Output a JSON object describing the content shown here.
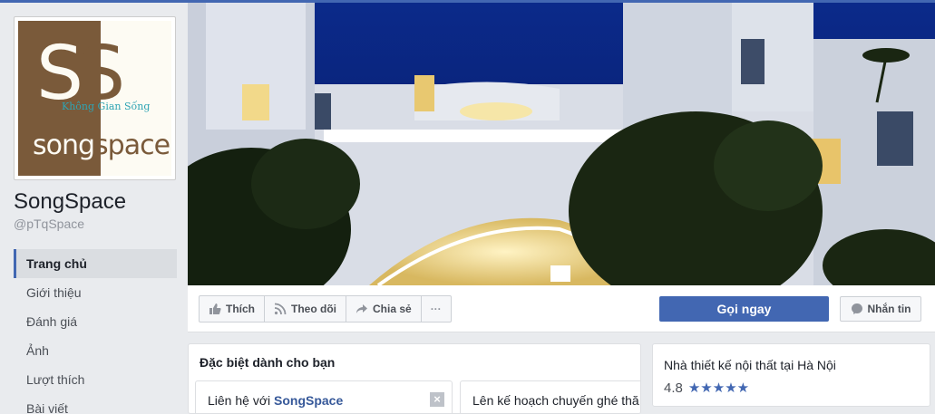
{
  "page": {
    "name": "SongSpace",
    "handle": "@pTqSpace"
  },
  "logo": {
    "letter1": "S",
    "letter2": "S",
    "tagline": "Không Gian Sống",
    "word_part1": "song",
    "word_part2": "space"
  },
  "nav": [
    {
      "label": "Trang chủ",
      "active": true
    },
    {
      "label": "Giới thiệu"
    },
    {
      "label": "Đánh giá"
    },
    {
      "label": "Ảnh"
    },
    {
      "label": "Lượt thích"
    },
    {
      "label": "Bài viết"
    }
  ],
  "actions": {
    "like": "Thích",
    "follow": "Theo dõi",
    "share": "Chia sẻ",
    "more": "···",
    "call": "Gọi ngay",
    "message": "Nhắn tin"
  },
  "special": {
    "title": "Đặc biệt dành cho bạn",
    "card1_prefix": "Liên hệ với",
    "card1_brand": "SongSpace",
    "card1_close": "×",
    "card2_text": "Lên kế hoạch chuyến ghé thă"
  },
  "info": {
    "description": "Nhà thiết kế nội thất tại Hà Nội",
    "rating_value": "4.8",
    "stars": "★★★★★"
  },
  "colors": {
    "brand_blue": "#4267b2",
    "logo_brown": "#7a5a3a"
  },
  "icons": {
    "like": "thumbs-up-icon",
    "follow": "rss-icon",
    "share": "share-arrow-icon",
    "message": "messenger-icon",
    "close": "close-icon"
  }
}
